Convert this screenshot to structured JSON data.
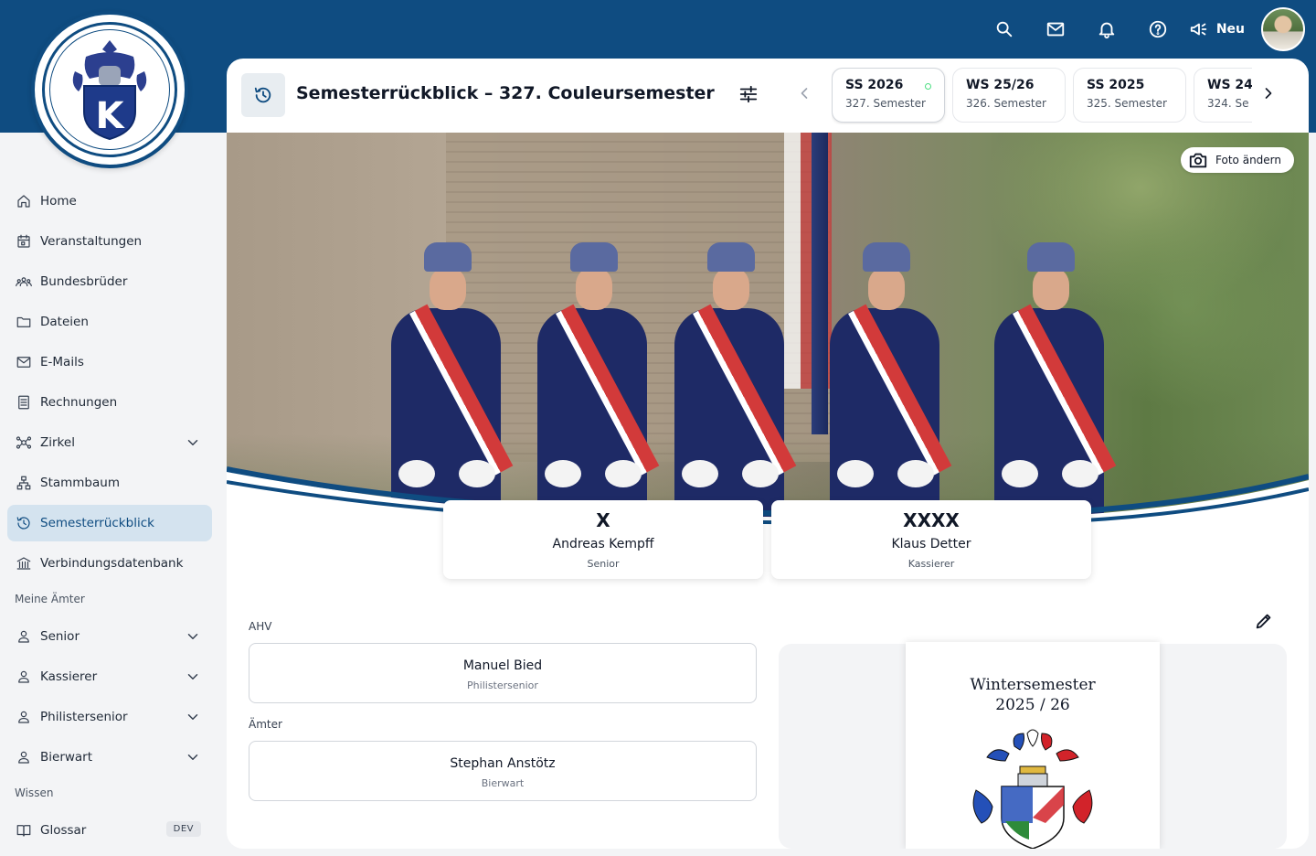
{
  "topbar": {
    "icons": [
      "search-icon",
      "mail-icon",
      "bell-icon",
      "help-icon"
    ],
    "new_label": "Neu"
  },
  "logo": {
    "letter": "K"
  },
  "sidebar": {
    "items": [
      {
        "label": "Home",
        "icon": "home-icon"
      },
      {
        "label": "Veranstaltungen",
        "icon": "calendar-icon"
      },
      {
        "label": "Bundesbrüder",
        "icon": "people-icon"
      },
      {
        "label": "Dateien",
        "icon": "folder-icon"
      },
      {
        "label": "E-Mails",
        "icon": "mail-icon"
      },
      {
        "label": "Rechnungen",
        "icon": "invoice-icon"
      },
      {
        "label": "Zirkel",
        "icon": "circle-network-icon",
        "expandable": true
      },
      {
        "label": "Stammbaum",
        "icon": "tree-icon"
      },
      {
        "label": "Semesterrückblick",
        "icon": "history-icon",
        "active": true
      },
      {
        "label": "Verbindungsdatenbank",
        "icon": "building-icon"
      }
    ],
    "section_offices": "Meine Ämter",
    "offices": [
      {
        "label": "Senior"
      },
      {
        "label": "Kassierer"
      },
      {
        "label": "Philistersenior"
      },
      {
        "label": "Bierwart"
      }
    ],
    "section_knowledge": "Wissen",
    "knowledge": [
      {
        "label": "Glossar",
        "badge": "DEV"
      }
    ]
  },
  "header": {
    "title": "Semesterrückblick – 327. Couleursemester"
  },
  "semesters": [
    {
      "name": "SS 2026",
      "number": "327. Semester",
      "active": true
    },
    {
      "name": "WS 25/26",
      "number": "326. Semester"
    },
    {
      "name": "SS 2025",
      "number": "325. Semester"
    },
    {
      "name": "WS 24",
      "number": "324. Se"
    }
  ],
  "photo": {
    "change_label": "Foto ändern"
  },
  "officers": [
    {
      "symbol": "X",
      "name": "Andreas Kempff",
      "role": "Senior"
    },
    {
      "symbol": "XXXX",
      "name": "Klaus Detter",
      "role": "Kassierer"
    }
  ],
  "ahv": {
    "label": "AHV",
    "entries": [
      {
        "name": "Manuel Bied",
        "role": "Philistersenior"
      }
    ]
  },
  "aemter": {
    "label": "Ämter",
    "entries": [
      {
        "name": "Stephan Anstötz",
        "role": "Bierwart"
      }
    ]
  },
  "cover": {
    "line1": "Wintersemester",
    "line2": "2025 / 26"
  },
  "colors": {
    "brand": "#0f4c81",
    "active_bg": "#d4e3ef",
    "sash_red": "#d23a3a"
  }
}
